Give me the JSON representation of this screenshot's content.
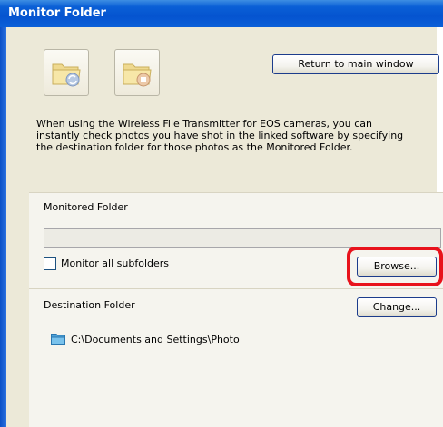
{
  "window": {
    "title": "Monitor Folder"
  },
  "toolbar": {
    "icons": [
      {
        "name": "folder-sync-icon"
      },
      {
        "name": "folder-stop-icon"
      }
    ],
    "return_label": "Return to main window"
  },
  "description": "When using the Wireless File Transmitter for EOS cameras, you can instantly check photos you have shot in the linked software by specifying the destination folder for those photos as the Monitored Folder.",
  "monitored": {
    "heading": "Monitored Folder",
    "path_value": "",
    "subfolders_label": "Monitor all subfolders",
    "subfolders_checked": false,
    "browse_label": "Browse..."
  },
  "destination": {
    "heading": "Destination Folder",
    "change_label": "Change...",
    "path": "C:\\Documents and Settings\\Photo"
  },
  "colors": {
    "title_bar": "#0554d0",
    "highlight": "#e8121b"
  }
}
